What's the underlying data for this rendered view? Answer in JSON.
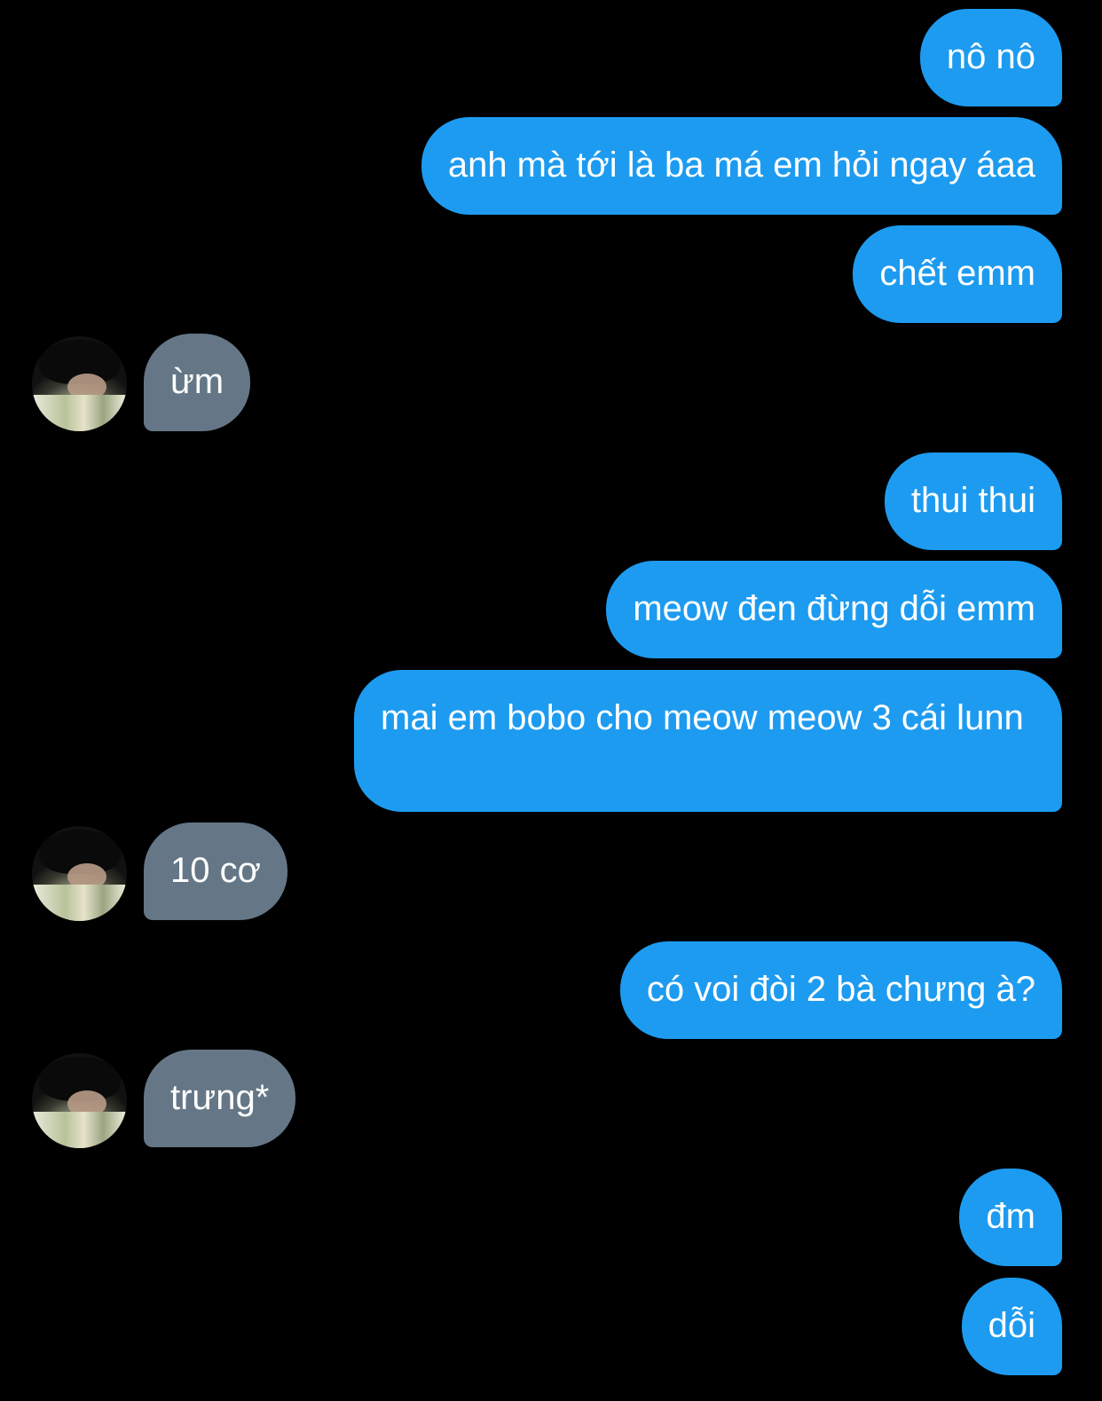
{
  "messages": [
    {
      "dir": "out",
      "text": "nô nô"
    },
    {
      "dir": "out",
      "text": "anh mà tới là ba má em hỏi ngay áaa"
    },
    {
      "dir": "out",
      "text": "chết emm"
    },
    {
      "dir": "in",
      "text": "ừm"
    },
    {
      "dir": "out",
      "text": "thui thui"
    },
    {
      "dir": "out",
      "text": "meow đen đừng dỗi emm"
    },
    {
      "dir": "out",
      "text": "mai em bobo cho meow meow 3 cái lunn"
    },
    {
      "dir": "in",
      "text": "10 cơ"
    },
    {
      "dir": "out",
      "text": "có voi đòi 2 bà chưng à?"
    },
    {
      "dir": "in",
      "text": "trưng*"
    },
    {
      "dir": "out",
      "text": "đm"
    },
    {
      "dir": "out",
      "text": "dỗi"
    }
  ],
  "colors": {
    "background": "#000000",
    "outgoing_bubble": "#1d9bf0",
    "incoming_bubble": "#657786",
    "text": "#ffffff"
  },
  "icons": {
    "avatar": "contact-avatar-photo"
  }
}
